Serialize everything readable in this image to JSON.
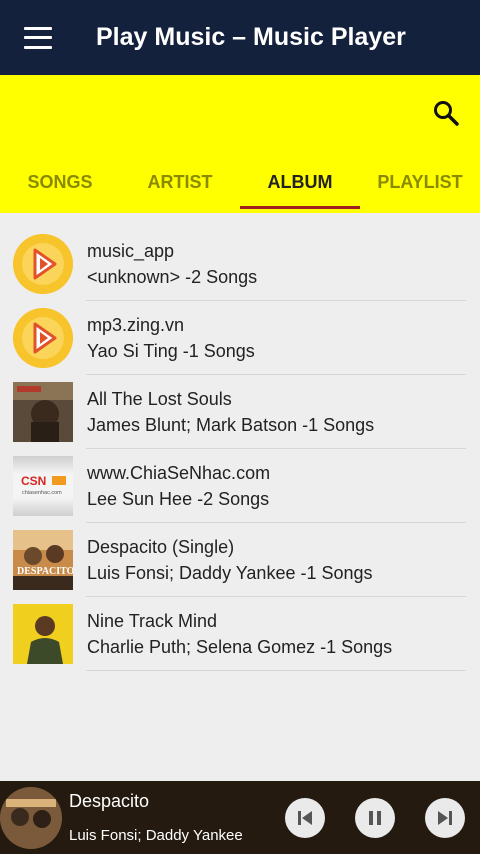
{
  "header": {
    "title": "Play Music – Music Player"
  },
  "tabs": [
    {
      "label": "SONGS"
    },
    {
      "label": "ARTIST"
    },
    {
      "label": "ALBUM"
    },
    {
      "label": "PLAYLIST"
    }
  ],
  "albums": [
    {
      "title": "music_app",
      "subtitle": "<unknown> -2 Songs"
    },
    {
      "title": "mp3.zing.vn",
      "subtitle": "Yao Si Ting -1 Songs"
    },
    {
      "title": "All The Lost Souls",
      "subtitle": "James Blunt; Mark Batson -1 Songs"
    },
    {
      "title": "www.ChiaSeNhac.com",
      "subtitle": "Lee Sun Hee -2 Songs"
    },
    {
      "title": "Despacito (Single)",
      "subtitle": "Luis Fonsi; Daddy Yankee -1 Songs"
    },
    {
      "title": "Nine Track Mind",
      "subtitle": "Charlie Puth; Selena Gomez -1 Songs"
    }
  ],
  "art_text": {
    "csn_logo": "CSN",
    "csn_url": "chiasenhac.com",
    "despacito": "DESPACITO"
  },
  "player": {
    "title": "Despacito",
    "artist": "Luis Fonsi; Daddy Yankee"
  }
}
